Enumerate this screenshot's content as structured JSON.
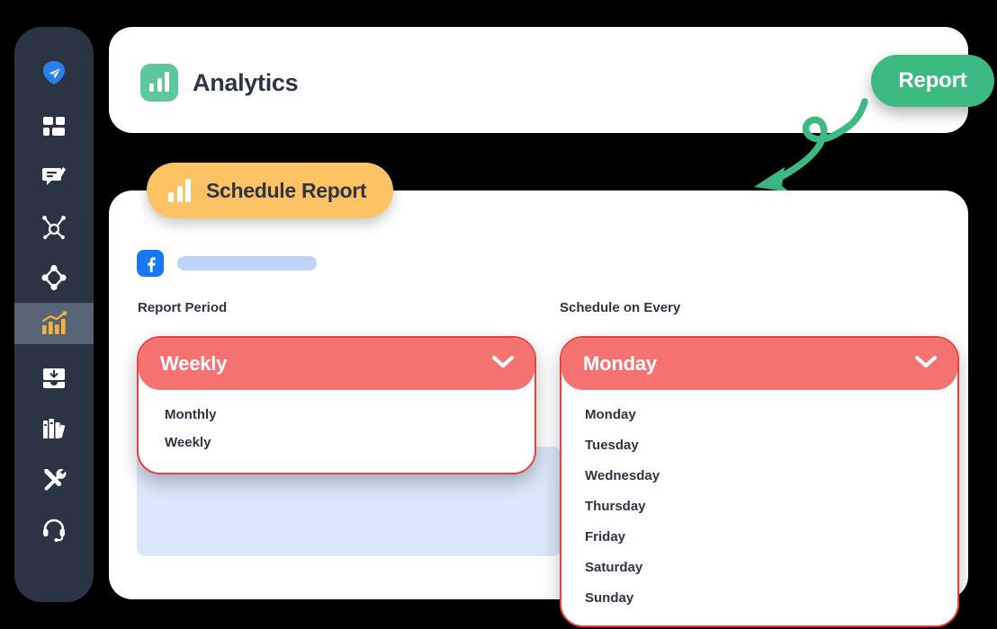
{
  "sidebar": {
    "background_color": "#2b3445",
    "active_background_color": "#5a6477",
    "items": [
      {
        "name": "logo-paper-plane",
        "label": "Logo",
        "icon": "paper-plane-icon",
        "active": false,
        "color": "#2a7fe8"
      },
      {
        "name": "dashboard",
        "label": "Dashboard",
        "icon": "grid-dashboard-icon",
        "active": false,
        "color": "#ffffff"
      },
      {
        "name": "messages",
        "label": "Messages",
        "icon": "chat-pencil-icon",
        "active": false,
        "color": "#ffffff"
      },
      {
        "name": "network",
        "label": "Network",
        "icon": "network-nodes-icon",
        "active": false,
        "color": "#ffffff"
      },
      {
        "name": "campaigns",
        "label": "Campaigns",
        "icon": "diamond-nodes-icon",
        "active": false,
        "color": "#ffffff"
      },
      {
        "name": "analytics",
        "label": "Analytics",
        "icon": "bar-chart-trend-icon",
        "active": true,
        "color": "#f5b33c"
      },
      {
        "name": "inbox",
        "label": "Inbox",
        "icon": "inbox-download-icon",
        "active": false,
        "color": "#ffffff"
      },
      {
        "name": "library",
        "label": "Library",
        "icon": "books-icon",
        "active": false,
        "color": "#ffffff"
      },
      {
        "name": "tools",
        "label": "Tools",
        "icon": "wrench-screwdriver-icon",
        "active": false,
        "color": "#ffffff"
      },
      {
        "name": "support",
        "label": "Support",
        "icon": "headset-icon",
        "active": false,
        "color": "#ffffff"
      }
    ]
  },
  "header": {
    "title": "Analytics",
    "icon": "bar-chart-icon",
    "icon_background": "#5cc79a",
    "report_button": {
      "label": "Report",
      "color": "#3cba82"
    },
    "annotation_arrow": {
      "name": "curly-arrow-annotation",
      "color": "#3cba82"
    }
  },
  "tab": {
    "label": "Schedule Report",
    "icon": "bar-chart-icon",
    "background": "#fcc264"
  },
  "account": {
    "platform_icon": "facebook-icon",
    "platform_color": "#1877f2",
    "placeholder_bar_color": "#bdd3f7"
  },
  "form": {
    "accent_color": "#f4726f",
    "border_color": "#e8413e",
    "report_period": {
      "label": "Report Period",
      "selected": "Weekly",
      "chevron": "chevron-down-icon",
      "options": [
        "Monthly",
        "Weekly"
      ]
    },
    "schedule_on_every": {
      "label": "Schedule on Every",
      "selected": "Monday",
      "chevron": "chevron-down-icon",
      "options": [
        "Monday",
        "Tuesday",
        "Wednesday",
        "Thursday",
        "Friday",
        "Saturday",
        "Sunday"
      ]
    }
  },
  "preview_panel": {
    "background": "#dbe7fa",
    "bar_color": "#bdd3f7"
  }
}
